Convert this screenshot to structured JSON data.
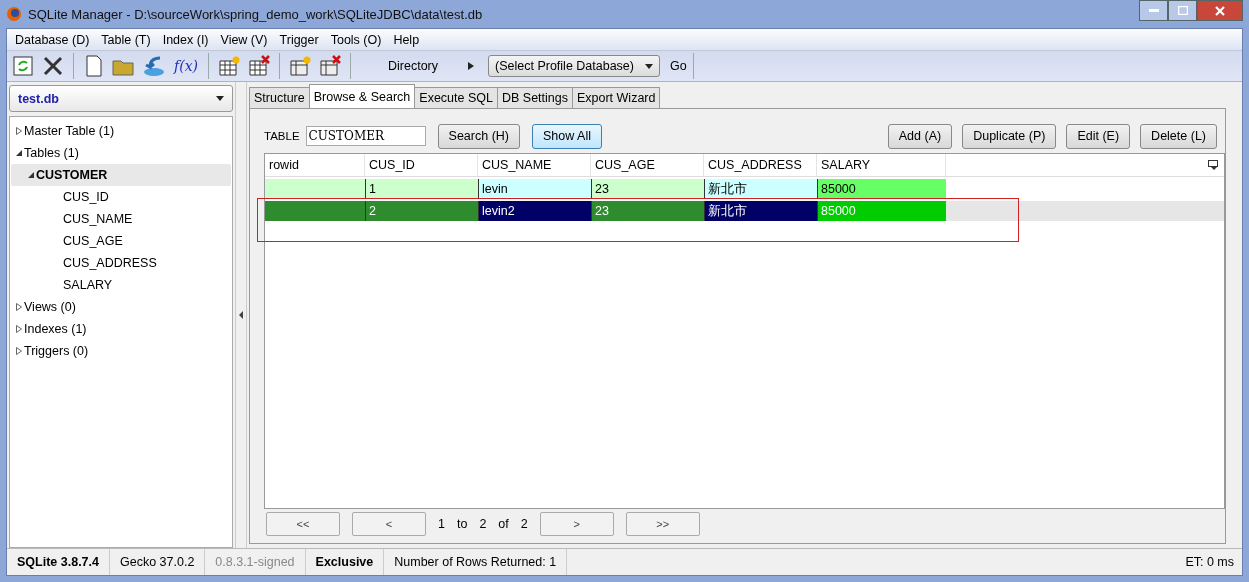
{
  "window": {
    "title": "SQLite Manager - D:\\sourceWork\\spring_demo_work\\SQLiteJDBC\\data\\test.db"
  },
  "menu": [
    "Database (D)",
    "Table (T)",
    "Index (I)",
    "View (V)",
    "Trigger",
    "Tools (O)",
    "Help"
  ],
  "toolbar": {
    "function_label": "f(x)",
    "directory_label": "Directory",
    "profile_select": "(Select Profile Database)",
    "go_button": "Go"
  },
  "database_select": "test.db",
  "tree": [
    {
      "label": "Master Table (1)",
      "expanded": false,
      "selected": false
    },
    {
      "label": "Tables (1)",
      "expanded": true,
      "selected": false,
      "children": [
        {
          "label": "CUSTOMER",
          "expanded": true,
          "selected": true,
          "children": [
            {
              "label": "CUS_ID",
              "selected": false
            },
            {
              "label": "CUS_NAME",
              "selected": false
            },
            {
              "label": "CUS_AGE",
              "selected": false
            },
            {
              "label": "CUS_ADDRESS",
              "selected": false
            },
            {
              "label": "SALARY",
              "selected": false
            }
          ]
        }
      ]
    },
    {
      "label": "Views (0)",
      "expanded": false,
      "selected": false
    },
    {
      "label": "Indexes (1)",
      "expanded": false,
      "selected": false
    },
    {
      "label": "Triggers (0)",
      "expanded": false,
      "selected": false
    }
  ],
  "tabs": [
    {
      "label": "Structure",
      "selected": false
    },
    {
      "label": "Browse & Search",
      "selected": true
    },
    {
      "label": "Execute SQL",
      "selected": false
    },
    {
      "label": "DB Settings",
      "selected": false
    },
    {
      "label": "Export Wizard",
      "selected": false
    }
  ],
  "table_label": "TABLE",
  "table_field": "CUSTOMER",
  "left_buttons": [
    {
      "label": "Search (H)",
      "focused": false
    },
    {
      "label": "Show All",
      "focused": true
    }
  ],
  "right_buttons": [
    "Add (A)",
    "Duplicate (P)",
    "Edit (E)",
    "Delete (L)"
  ],
  "grid": {
    "columns": [
      {
        "label": "rowid",
        "kind": "integer"
      },
      {
        "label": "CUS_ID",
        "kind": "integer"
      },
      {
        "label": "CUS_NAME",
        "kind": "text"
      },
      {
        "label": "CUS_AGE",
        "kind": "integer"
      },
      {
        "label": "CUS_ADDRESS",
        "kind": "text"
      },
      {
        "label": "SALARY",
        "kind": "real"
      }
    ],
    "rows": [
      {
        "selected": false,
        "cells": [
          "",
          "1",
          "levin",
          "23",
          "新北市",
          "85000"
        ]
      },
      {
        "selected": true,
        "cells": [
          "",
          "2",
          "levin2",
          "23",
          "新北市",
          "85000"
        ]
      }
    ]
  },
  "pager": {
    "first": "<<",
    "prev": "<",
    "from": "1",
    "to_word": "to",
    "to": "2",
    "of_word": "of",
    "total": "2",
    "next": ">",
    "last": ">>"
  },
  "status_bar": [
    {
      "text": "SQLite 3.8.7.4",
      "kind": "bold"
    },
    {
      "text": "Gecko 37.0.2",
      "kind": "plain"
    },
    {
      "text": "0.8.3.1-signed",
      "kind": "muted"
    },
    {
      "text": "Exclusive",
      "kind": "bold"
    },
    {
      "text": "Number of Rows Returned: 1",
      "kind": "plain"
    }
  ],
  "elapsed": "ET: 0 ms"
}
